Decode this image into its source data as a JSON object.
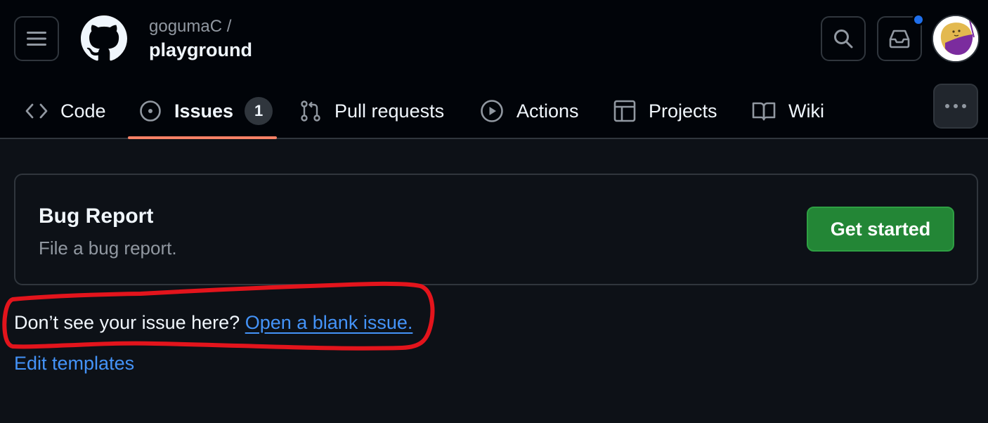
{
  "header": {
    "owner": "gogumaC /",
    "repo": "playground",
    "icons": [
      "menu-icon",
      "github-logo",
      "search-icon",
      "inbox-icon",
      "avatar"
    ],
    "notification_color": "#1f6feb"
  },
  "tabs": [
    {
      "label": "Code",
      "icon": "code-icon"
    },
    {
      "label": "Issues",
      "icon": "issue-opened-icon",
      "count": "1",
      "selected": true
    },
    {
      "label": "Pull requests",
      "icon": "git-pull-request-icon"
    },
    {
      "label": "Actions",
      "icon": "play-icon"
    },
    {
      "label": "Projects",
      "icon": "table-icon"
    },
    {
      "label": "Wiki",
      "icon": "book-icon"
    }
  ],
  "template": {
    "name": "Bug Report",
    "description": "File a bug report.",
    "button_label": "Get started"
  },
  "footer": {
    "prompt": "Don’t see your issue here?",
    "blank_issue_link": "Open a blank issue.",
    "edit_templates": "Edit templates"
  },
  "colors": {
    "background": "#0d1117",
    "header_background": "#010409",
    "accent_underline": "#f78166",
    "primary_button": "#238636",
    "link": "#4493f8",
    "annotation": "#e3141c"
  }
}
